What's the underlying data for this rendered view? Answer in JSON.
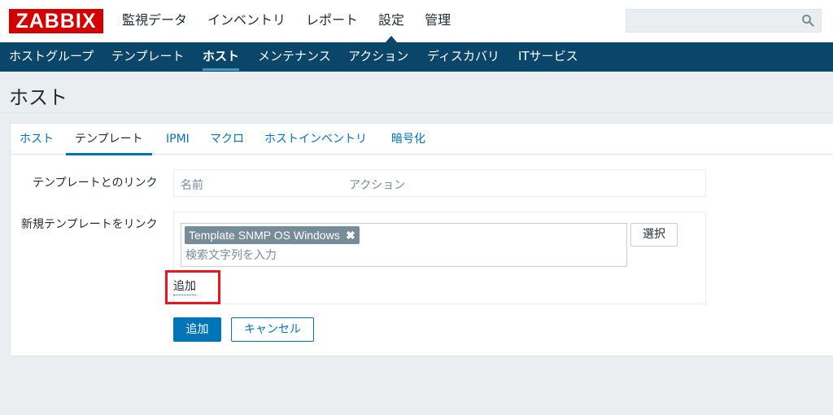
{
  "header": {
    "logo": "ZABBIX",
    "menu": [
      "監視データ",
      "インベントリ",
      "レポート",
      "設定",
      "管理"
    ],
    "selected_menu": "設定"
  },
  "search": {
    "placeholder": ""
  },
  "subnav": {
    "items": [
      "ホストグループ",
      "テンプレート",
      "ホスト",
      "メンテナンス",
      "アクション",
      "ディスカバリ",
      "ITサービス"
    ],
    "selected": "ホスト"
  },
  "page_title": "ホスト",
  "tabs": {
    "items": [
      "ホスト",
      "テンプレート",
      "IPMI",
      "マクロ",
      "ホストインベントリ",
      "暗号化"
    ],
    "selected": "テンプレート"
  },
  "form": {
    "linked_templates_label": "テンプレートとのリンク",
    "linked_columns": {
      "name": "名前",
      "action": "アクション"
    },
    "new_link_label": "新規テンプレートをリンク",
    "selected_template": "Template SNMP OS Windows",
    "remove_glyph": "✖",
    "search_placeholder": "検索文字列を入力",
    "select_button": "選択",
    "add_link": "追加",
    "submit_button": "追加",
    "cancel_button": "キャンセル"
  },
  "colors": {
    "logo_red": "#d40000",
    "nav_blue": "#0a466a",
    "link_blue": "#0275b8",
    "highlight_red": "#e8191e"
  }
}
